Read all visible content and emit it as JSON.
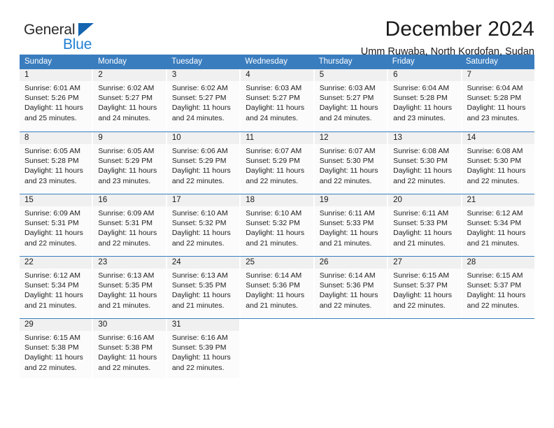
{
  "brand": {
    "name_top": "General",
    "name_bottom": "Blue",
    "triangle_color": "#1565b0",
    "blue_color": "#1f7fd4"
  },
  "header": {
    "month_title": "December 2024",
    "location": "Umm Ruwaba, North Kordofan, Sudan"
  },
  "theme": {
    "header_blue": "#3a7dbf",
    "daynum_gray": "#f0f0f0",
    "cell_white": "#ffffff"
  },
  "calendar": {
    "weekdays": [
      "Sunday",
      "Monday",
      "Tuesday",
      "Wednesday",
      "Thursday",
      "Friday",
      "Saturday"
    ],
    "weeks": [
      [
        {
          "day": "1",
          "sunrise": "Sunrise: 6:01 AM",
          "sunset": "Sunset: 5:26 PM",
          "daylight1": "Daylight: 11 hours",
          "daylight2": "and 25 minutes."
        },
        {
          "day": "2",
          "sunrise": "Sunrise: 6:02 AM",
          "sunset": "Sunset: 5:27 PM",
          "daylight1": "Daylight: 11 hours",
          "daylight2": "and 24 minutes."
        },
        {
          "day": "3",
          "sunrise": "Sunrise: 6:02 AM",
          "sunset": "Sunset: 5:27 PM",
          "daylight1": "Daylight: 11 hours",
          "daylight2": "and 24 minutes."
        },
        {
          "day": "4",
          "sunrise": "Sunrise: 6:03 AM",
          "sunset": "Sunset: 5:27 PM",
          "daylight1": "Daylight: 11 hours",
          "daylight2": "and 24 minutes."
        },
        {
          "day": "5",
          "sunrise": "Sunrise: 6:03 AM",
          "sunset": "Sunset: 5:27 PM",
          "daylight1": "Daylight: 11 hours",
          "daylight2": "and 24 minutes."
        },
        {
          "day": "6",
          "sunrise": "Sunrise: 6:04 AM",
          "sunset": "Sunset: 5:28 PM",
          "daylight1": "Daylight: 11 hours",
          "daylight2": "and 23 minutes."
        },
        {
          "day": "7",
          "sunrise": "Sunrise: 6:04 AM",
          "sunset": "Sunset: 5:28 PM",
          "daylight1": "Daylight: 11 hours",
          "daylight2": "and 23 minutes."
        }
      ],
      [
        {
          "day": "8",
          "sunrise": "Sunrise: 6:05 AM",
          "sunset": "Sunset: 5:28 PM",
          "daylight1": "Daylight: 11 hours",
          "daylight2": "and 23 minutes."
        },
        {
          "day": "9",
          "sunrise": "Sunrise: 6:05 AM",
          "sunset": "Sunset: 5:29 PM",
          "daylight1": "Daylight: 11 hours",
          "daylight2": "and 23 minutes."
        },
        {
          "day": "10",
          "sunrise": "Sunrise: 6:06 AM",
          "sunset": "Sunset: 5:29 PM",
          "daylight1": "Daylight: 11 hours",
          "daylight2": "and 22 minutes."
        },
        {
          "day": "11",
          "sunrise": "Sunrise: 6:07 AM",
          "sunset": "Sunset: 5:29 PM",
          "daylight1": "Daylight: 11 hours",
          "daylight2": "and 22 minutes."
        },
        {
          "day": "12",
          "sunrise": "Sunrise: 6:07 AM",
          "sunset": "Sunset: 5:30 PM",
          "daylight1": "Daylight: 11 hours",
          "daylight2": "and 22 minutes."
        },
        {
          "day": "13",
          "sunrise": "Sunrise: 6:08 AM",
          "sunset": "Sunset: 5:30 PM",
          "daylight1": "Daylight: 11 hours",
          "daylight2": "and 22 minutes."
        },
        {
          "day": "14",
          "sunrise": "Sunrise: 6:08 AM",
          "sunset": "Sunset: 5:30 PM",
          "daylight1": "Daylight: 11 hours",
          "daylight2": "and 22 minutes."
        }
      ],
      [
        {
          "day": "15",
          "sunrise": "Sunrise: 6:09 AM",
          "sunset": "Sunset: 5:31 PM",
          "daylight1": "Daylight: 11 hours",
          "daylight2": "and 22 minutes."
        },
        {
          "day": "16",
          "sunrise": "Sunrise: 6:09 AM",
          "sunset": "Sunset: 5:31 PM",
          "daylight1": "Daylight: 11 hours",
          "daylight2": "and 22 minutes."
        },
        {
          "day": "17",
          "sunrise": "Sunrise: 6:10 AM",
          "sunset": "Sunset: 5:32 PM",
          "daylight1": "Daylight: 11 hours",
          "daylight2": "and 22 minutes."
        },
        {
          "day": "18",
          "sunrise": "Sunrise: 6:10 AM",
          "sunset": "Sunset: 5:32 PM",
          "daylight1": "Daylight: 11 hours",
          "daylight2": "and 21 minutes."
        },
        {
          "day": "19",
          "sunrise": "Sunrise: 6:11 AM",
          "sunset": "Sunset: 5:33 PM",
          "daylight1": "Daylight: 11 hours",
          "daylight2": "and 21 minutes."
        },
        {
          "day": "20",
          "sunrise": "Sunrise: 6:11 AM",
          "sunset": "Sunset: 5:33 PM",
          "daylight1": "Daylight: 11 hours",
          "daylight2": "and 21 minutes."
        },
        {
          "day": "21",
          "sunrise": "Sunrise: 6:12 AM",
          "sunset": "Sunset: 5:34 PM",
          "daylight1": "Daylight: 11 hours",
          "daylight2": "and 21 minutes."
        }
      ],
      [
        {
          "day": "22",
          "sunrise": "Sunrise: 6:12 AM",
          "sunset": "Sunset: 5:34 PM",
          "daylight1": "Daylight: 11 hours",
          "daylight2": "and 21 minutes."
        },
        {
          "day": "23",
          "sunrise": "Sunrise: 6:13 AM",
          "sunset": "Sunset: 5:35 PM",
          "daylight1": "Daylight: 11 hours",
          "daylight2": "and 21 minutes."
        },
        {
          "day": "24",
          "sunrise": "Sunrise: 6:13 AM",
          "sunset": "Sunset: 5:35 PM",
          "daylight1": "Daylight: 11 hours",
          "daylight2": "and 21 minutes."
        },
        {
          "day": "25",
          "sunrise": "Sunrise: 6:14 AM",
          "sunset": "Sunset: 5:36 PM",
          "daylight1": "Daylight: 11 hours",
          "daylight2": "and 21 minutes."
        },
        {
          "day": "26",
          "sunrise": "Sunrise: 6:14 AM",
          "sunset": "Sunset: 5:36 PM",
          "daylight1": "Daylight: 11 hours",
          "daylight2": "and 22 minutes."
        },
        {
          "day": "27",
          "sunrise": "Sunrise: 6:15 AM",
          "sunset": "Sunset: 5:37 PM",
          "daylight1": "Daylight: 11 hours",
          "daylight2": "and 22 minutes."
        },
        {
          "day": "28",
          "sunrise": "Sunrise: 6:15 AM",
          "sunset": "Sunset: 5:37 PM",
          "daylight1": "Daylight: 11 hours",
          "daylight2": "and 22 minutes."
        }
      ],
      [
        {
          "day": "29",
          "sunrise": "Sunrise: 6:15 AM",
          "sunset": "Sunset: 5:38 PM",
          "daylight1": "Daylight: 11 hours",
          "daylight2": "and 22 minutes."
        },
        {
          "day": "30",
          "sunrise": "Sunrise: 6:16 AM",
          "sunset": "Sunset: 5:38 PM",
          "daylight1": "Daylight: 11 hours",
          "daylight2": "and 22 minutes."
        },
        {
          "day": "31",
          "sunrise": "Sunrise: 6:16 AM",
          "sunset": "Sunset: 5:39 PM",
          "daylight1": "Daylight: 11 hours",
          "daylight2": "and 22 minutes."
        },
        {
          "day": "",
          "sunrise": "",
          "sunset": "",
          "daylight1": "",
          "daylight2": ""
        },
        {
          "day": "",
          "sunrise": "",
          "sunset": "",
          "daylight1": "",
          "daylight2": ""
        },
        {
          "day": "",
          "sunrise": "",
          "sunset": "",
          "daylight1": "",
          "daylight2": ""
        },
        {
          "day": "",
          "sunrise": "",
          "sunset": "",
          "daylight1": "",
          "daylight2": ""
        }
      ]
    ]
  }
}
